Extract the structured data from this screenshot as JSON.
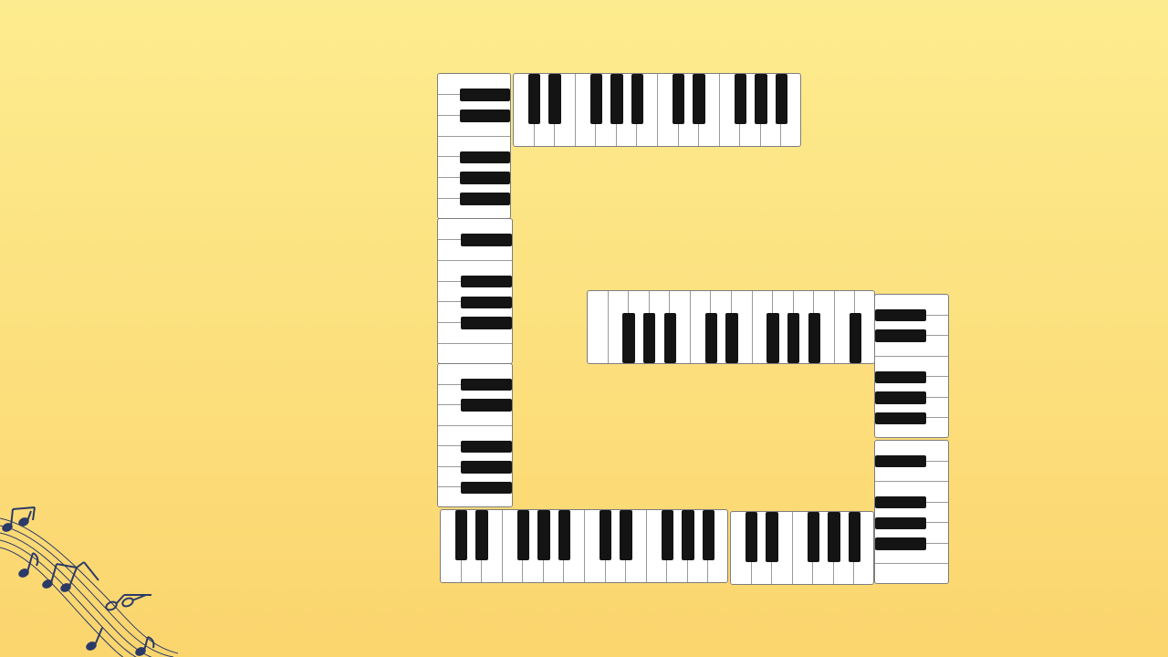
{
  "slide": {
    "name": "piano-letter-g-slide",
    "background_colors": [
      "#fdec8f",
      "#fbd56e"
    ]
  },
  "keyboard": {
    "white_key_color": "#ffffff",
    "black_key_color": "#141414",
    "outline_color": "#7d7d7d"
  },
  "decoration": {
    "icon": "music-notes-icon",
    "color": "#2b3a67"
  }
}
